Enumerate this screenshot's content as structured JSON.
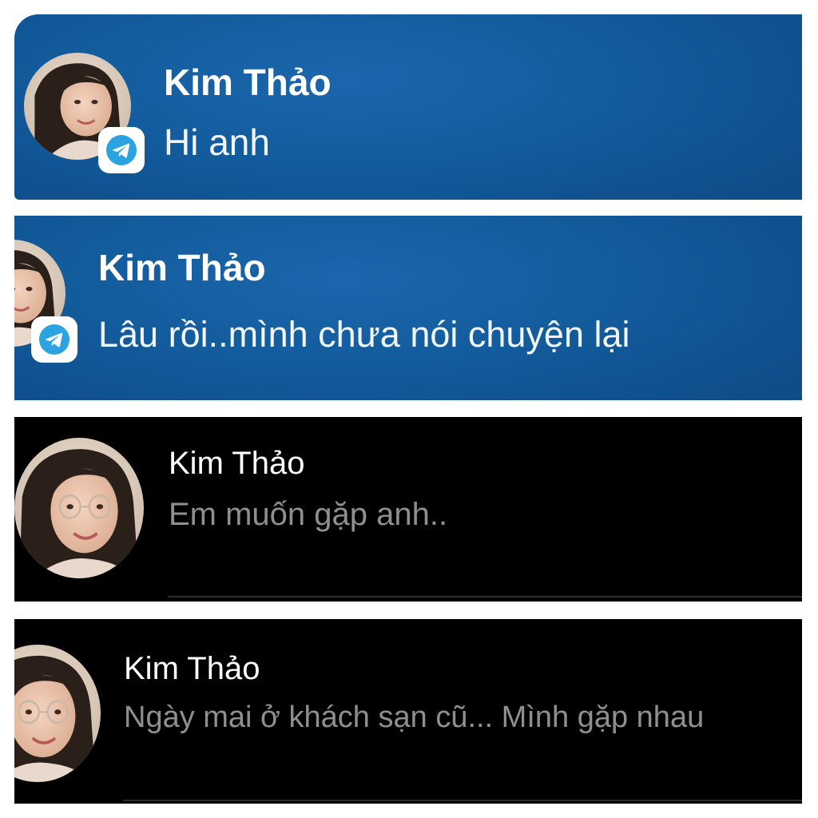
{
  "notifications": [
    {
      "sender": "Kim Thảo",
      "message": "Hi anh",
      "app_icon": "telegram-icon",
      "theme": "blue"
    },
    {
      "sender": "Kim Thảo",
      "message": "Lâu rồi..mình chưa nói chuyện lại",
      "app_icon": "telegram-icon",
      "theme": "blue"
    },
    {
      "sender": "Kim Thảo",
      "message": "Em muốn gặp anh..",
      "theme": "dark"
    },
    {
      "sender": "Kim Thảo",
      "message": "Ngày mai ở khách sạn cũ... Mình gặp nhau",
      "theme": "dark"
    }
  ],
  "colors": {
    "blue_panel": "#135d9e",
    "dark_panel": "#000000",
    "telegram": "#2aa3e0",
    "preview_gray": "#8e8e93"
  }
}
